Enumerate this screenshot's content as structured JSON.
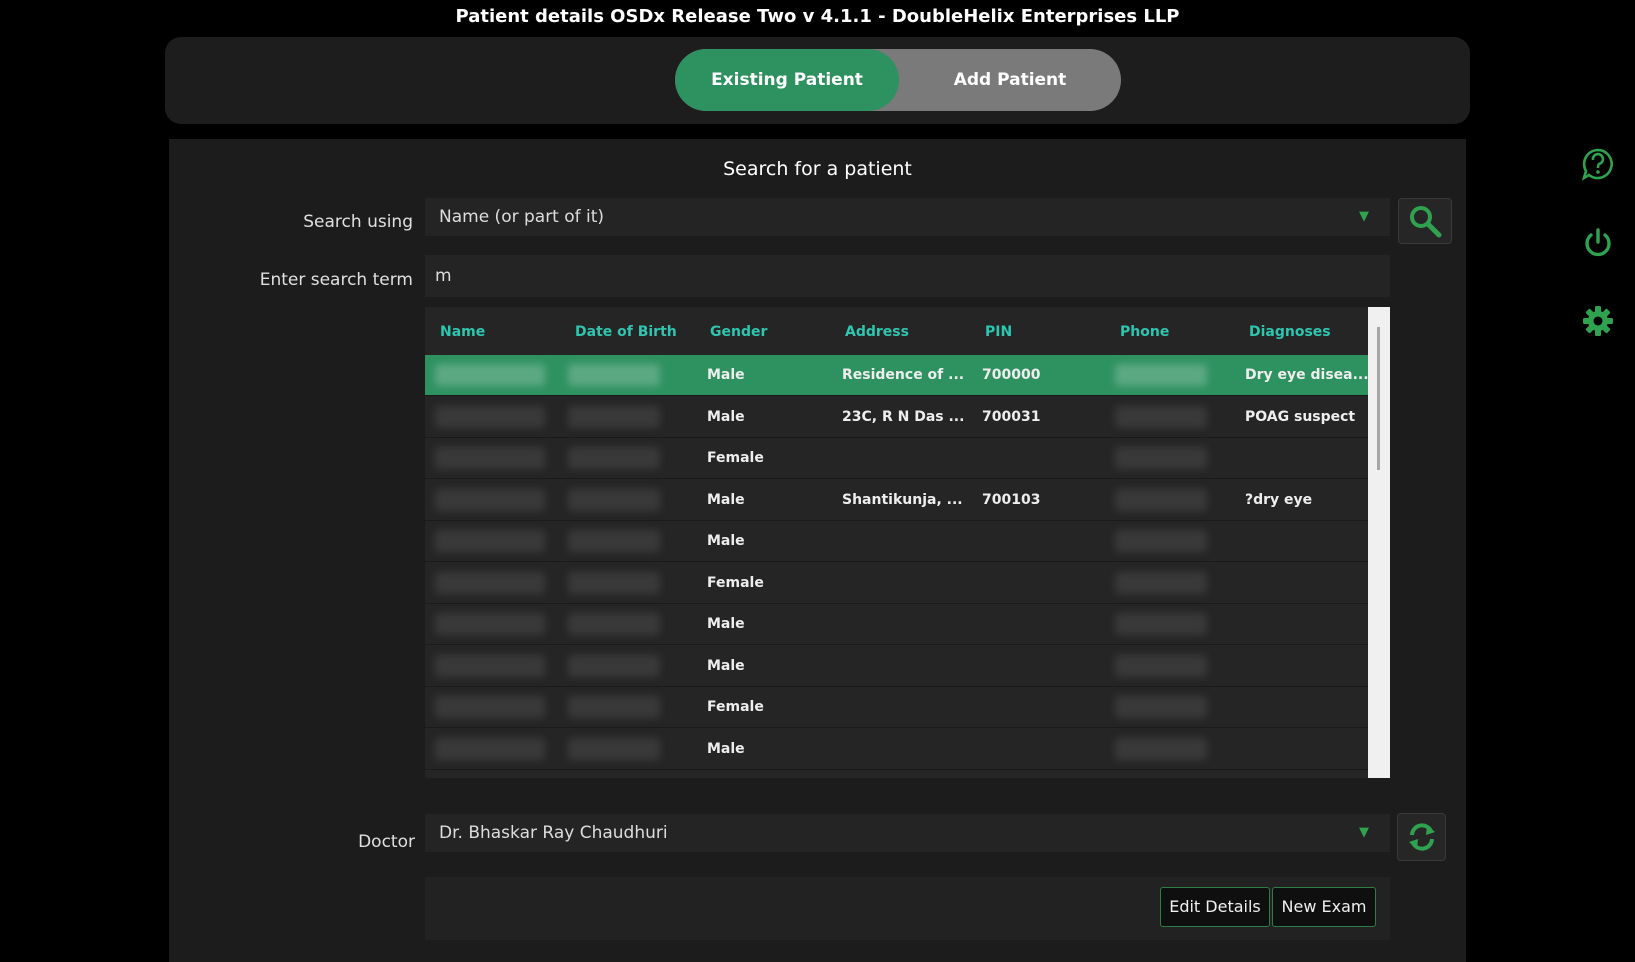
{
  "window": {
    "title": "Patient details OSDx Release Two v 4.1.1  - DoubleHelix Enterprises LLP"
  },
  "tabs": {
    "existing": "Existing Patient",
    "add": "Add Patient"
  },
  "search": {
    "heading": "Search for a patient",
    "using_label": "Search using",
    "using_value": "Name (or part of it)",
    "term_label": "Enter search term",
    "term_value": "m"
  },
  "table": {
    "columns": [
      "Name",
      "Date of Birth",
      "Gender",
      "Address",
      "PIN",
      "Phone",
      "Diagnoses"
    ],
    "rows": [
      {
        "gender": "Male",
        "address": "Residence of ...",
        "pin": "700000",
        "diagnoses": "Dry eye disea..."
      },
      {
        "gender": "Male",
        "address": "23C, R N Das ...",
        "pin": "700031",
        "diagnoses": "POAG suspect"
      },
      {
        "gender": "Female",
        "address": "",
        "pin": "",
        "diagnoses": ""
      },
      {
        "gender": "Male",
        "address": "Shantikunja, ...",
        "pin": "700103",
        "diagnoses": "?dry eye"
      },
      {
        "gender": "Male",
        "address": "",
        "pin": "",
        "diagnoses": ""
      },
      {
        "gender": "Female",
        "address": "",
        "pin": "",
        "diagnoses": ""
      },
      {
        "gender": "Male",
        "address": "",
        "pin": "",
        "diagnoses": ""
      },
      {
        "gender": "Male",
        "address": "",
        "pin": "",
        "diagnoses": ""
      },
      {
        "gender": "Female",
        "address": "",
        "pin": "",
        "diagnoses": ""
      },
      {
        "gender": "Male",
        "address": "",
        "pin": "",
        "diagnoses": ""
      }
    ]
  },
  "doctor": {
    "label": "Doctor",
    "value": "Dr. Bhaskar Ray Chaudhuri"
  },
  "buttons": {
    "edit": "Edit Details",
    "new_exam": "New Exam"
  },
  "icons": {
    "search": "search-icon",
    "refresh": "refresh-icon",
    "help": "help-icon",
    "power": "power-icon",
    "settings": "gear-icon",
    "dropdown": "chevron-down-icon"
  },
  "colors": {
    "accent": "#2e9160",
    "header_text": "#2fc6b0",
    "icon_green": "#2fa24f"
  }
}
